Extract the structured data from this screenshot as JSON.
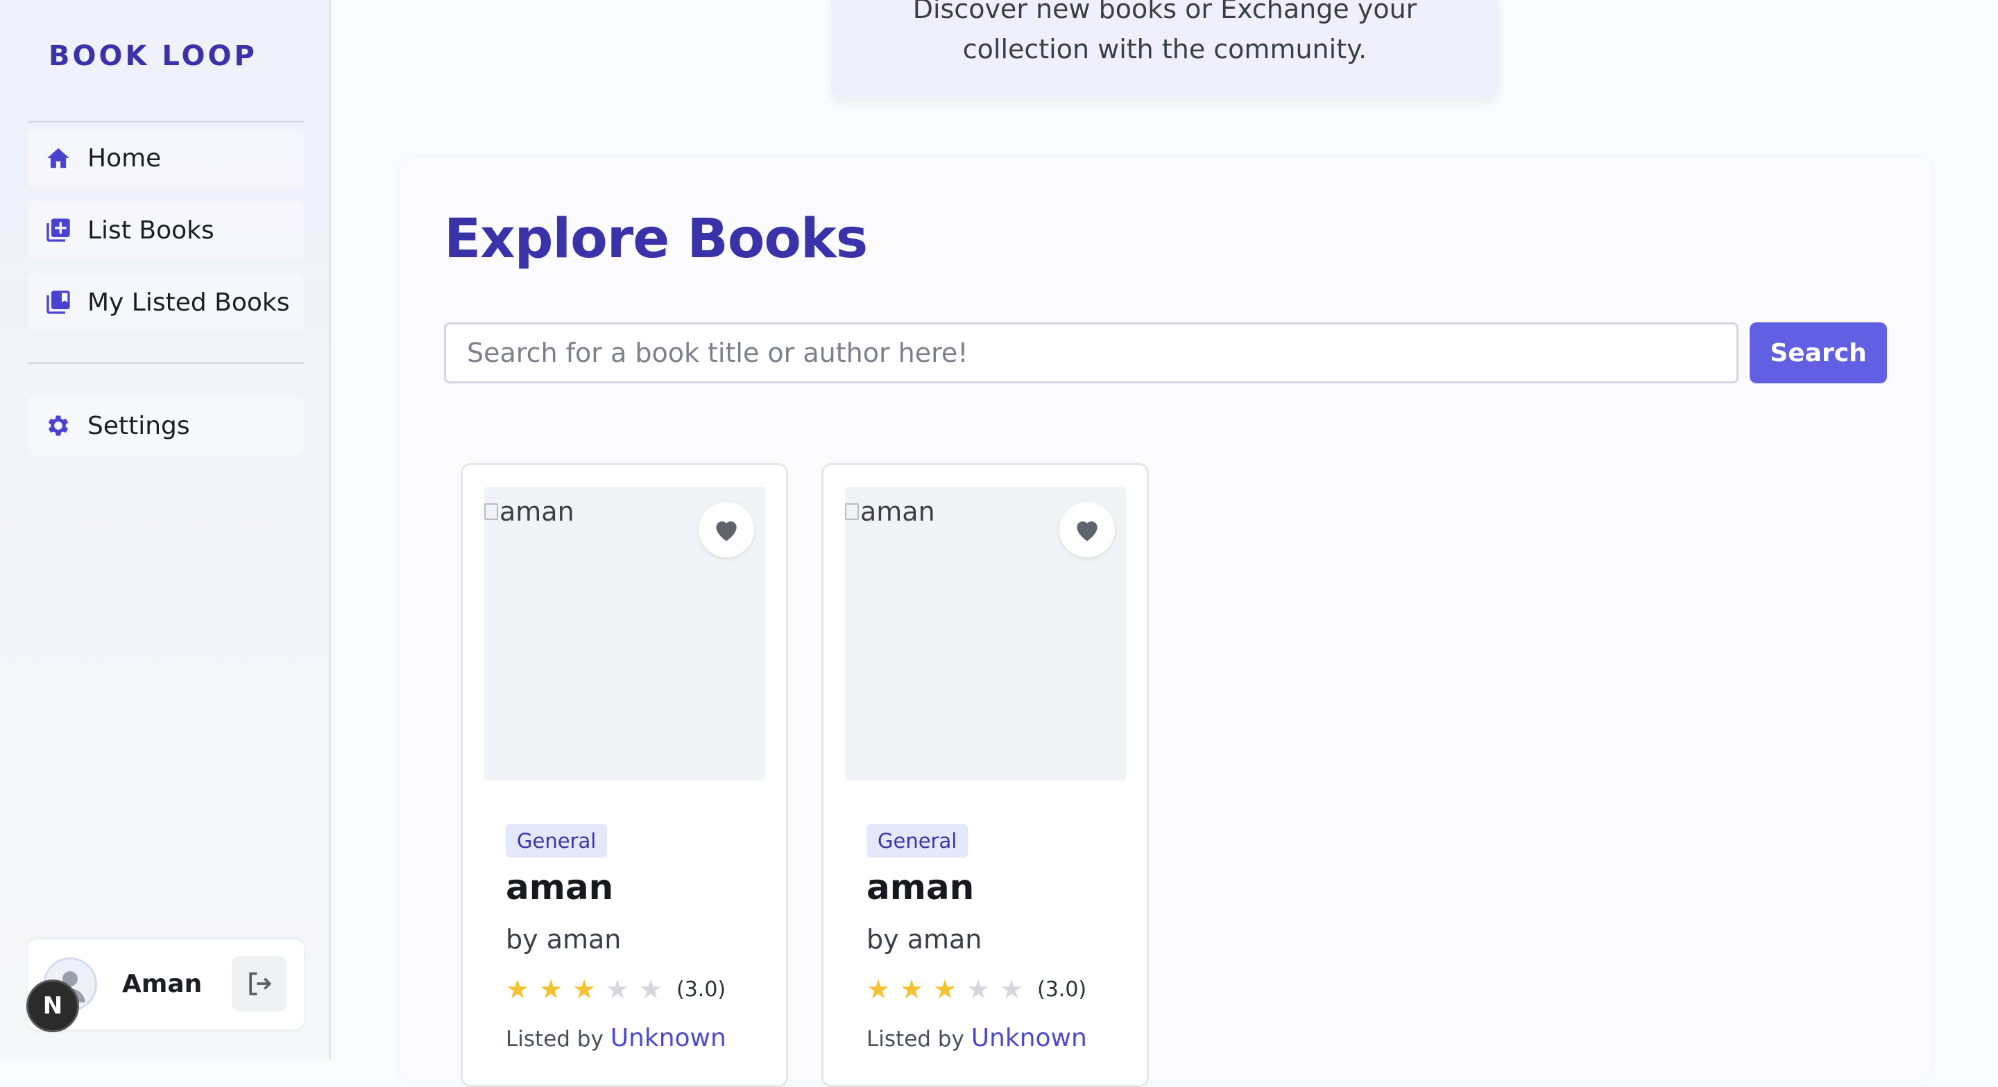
{
  "brand": "BOOK LOOP",
  "nav": {
    "home": "Home",
    "list_books": "List Books",
    "my_listed_books": "My Listed Books",
    "settings": "Settings"
  },
  "user": {
    "name": "Aman",
    "badge": "N"
  },
  "hero": {
    "line1": "Discover new books or Exchange your",
    "line2": "collection with the community."
  },
  "main": {
    "title": "Explore Books",
    "search_placeholder": "Search for a book title or author here!",
    "search_button": "Search"
  },
  "books": [
    {
      "alt": "aman",
      "genre": "General",
      "title": "aman",
      "author": "by aman",
      "rating": 3,
      "rating_text": "(3.0)",
      "listed_prefix": "Listed by",
      "listed_by": "Unknown"
    },
    {
      "alt": "aman",
      "genre": "General",
      "title": "aman",
      "author": "by aman",
      "rating": 3,
      "rating_text": "(3.0)",
      "listed_prefix": "Listed by",
      "listed_by": "Unknown"
    }
  ],
  "colors": {
    "accent": "#3a32a8",
    "button": "#6160e2",
    "star": "#f2c230"
  }
}
